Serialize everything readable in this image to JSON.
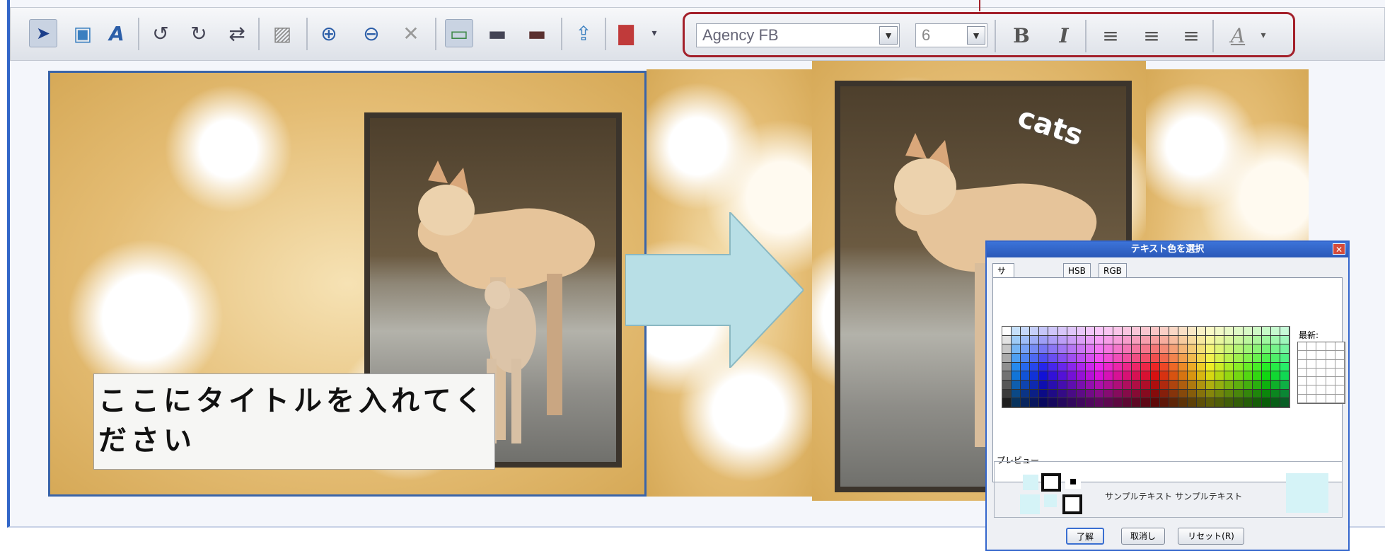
{
  "toolbar": {
    "font": {
      "name": "Agency FB",
      "size": "6"
    },
    "buttons": [
      {
        "name": "select-arrow-icon",
        "glyph": "➤"
      },
      {
        "name": "add-image-icon",
        "glyph": "▣"
      },
      {
        "name": "add-text-icon",
        "glyph": "A"
      },
      {
        "name": "rotate-left-icon",
        "glyph": "↺"
      },
      {
        "name": "rotate-right-icon",
        "glyph": "↻"
      },
      {
        "name": "flip-icon",
        "glyph": "⇄"
      },
      {
        "name": "pattern-icon",
        "glyph": "▨"
      },
      {
        "name": "zoom-in-icon",
        "glyph": "⊕"
      },
      {
        "name": "zoom-out-icon",
        "glyph": "⊖"
      },
      {
        "name": "fit-icon",
        "glyph": "✕"
      },
      {
        "name": "image-frame-icon",
        "glyph": "▭"
      },
      {
        "name": "image-dark-icon",
        "glyph": "▬"
      },
      {
        "name": "image-shadow-icon",
        "glyph": "▬"
      },
      {
        "name": "import-icon",
        "glyph": "⇪"
      },
      {
        "name": "chart-icon",
        "glyph": "▇"
      }
    ],
    "format_buttons": {
      "bold": "B",
      "italic": "I",
      "align_left": "≡",
      "align_center": "≡",
      "align_right": "≡",
      "text_color": "A"
    }
  },
  "page1": {
    "title_text": "ここにタイトルを入れてください"
  },
  "page2": {
    "overlay_text": "cats"
  },
  "color_dialog": {
    "title": "テキスト色を選択",
    "tabs": [
      "サンプル(S)",
      "HSB",
      "RGB"
    ],
    "recent_label": "最新:",
    "preview_label": "プレビュー",
    "preview_text": "サンプルテキスト サンプルテキスト",
    "buttons": {
      "ok": "了解",
      "cancel": "取消し",
      "reset": "リセット(R)"
    }
  },
  "colors": {
    "selection_border": "#a3202a",
    "frame_border": "#3a64a8",
    "arrow_fill": "#b8dfe6",
    "dialog_title_bar": "#2a58b8"
  }
}
